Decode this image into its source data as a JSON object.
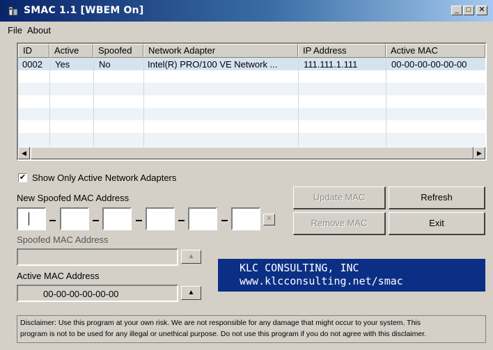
{
  "window": {
    "title": "SMAC 1.1  [WBEM On]",
    "controls": {
      "minimize": "_",
      "maximize": "□",
      "close": "✕"
    }
  },
  "menu": {
    "file": "File",
    "about": "About"
  },
  "adapters_table": {
    "columns": [
      "ID",
      "Active",
      "Spoofed",
      "Network Adapter",
      "IP Address",
      "Active MAC"
    ],
    "rows": [
      {
        "id": "0002",
        "active": "Yes",
        "spoofed": "No",
        "adapter": "Intel(R) PRO/100 VE Network ...",
        "ip": "111.111.1.111",
        "mac": "00-00-00-00-00-00"
      }
    ]
  },
  "show_only_active": {
    "label": "Show Only Active Network Adapters",
    "checked": true
  },
  "new_spoofed": {
    "label": "New Spoofed MAC Address",
    "octets": [
      "",
      "",
      "",
      "",
      "",
      ""
    ],
    "clear_glyph": "✕"
  },
  "buttons": {
    "update_mac": "Update MAC",
    "refresh": "Refresh",
    "remove_mac": "Remove MAC",
    "exit": "Exit"
  },
  "spoofed_mac": {
    "label": "Spoofed MAC Address",
    "value": ""
  },
  "active_mac": {
    "label": "Active MAC Address",
    "value": "00-00-00-00-00-00"
  },
  "banner": {
    "line1": "KLC CONSULTING, INC",
    "line2": "www.klcconsulting.net/smac"
  },
  "disclaimer": {
    "line1": "Disclaimer: Use this program at your own risk.  We are not responsible for any damage that might occur to your system.  This",
    "line2": "program is not to be used for any illegal or unethical purpose.  Do not use this program if you do not agree with this disclaimer."
  },
  "icons": [
    "app-icon",
    "minimize-icon",
    "maximize-icon",
    "close-icon",
    "scroll-left-icon",
    "scroll-right-icon",
    "check-icon",
    "clear-x-icon",
    "copy-up-icon"
  ],
  "colors": {
    "title_start": "#0a246a",
    "title_end": "#a6caf0",
    "banner_bg": "#0c2f86",
    "face": "#d4d0c8",
    "selected_row": "#d6e3ef"
  }
}
